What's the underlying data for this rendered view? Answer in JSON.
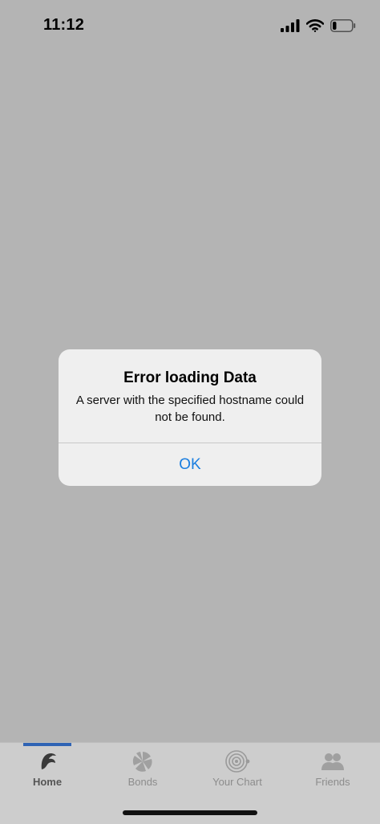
{
  "status_bar": {
    "time": "11:12",
    "icons": [
      "signal-icon",
      "wifi-icon",
      "battery-icon"
    ],
    "battery_level": 0.2
  },
  "alert": {
    "title": "Error loading Data",
    "message": "A server with the specified hostname could not be found.",
    "ok_label": "OK",
    "ok_color": "#1a7ee0"
  },
  "tab_bar": {
    "selected": "Home",
    "accent_color": "#2f63b4",
    "tabs": [
      {
        "label": "Home",
        "icon": "home-icon"
      },
      {
        "label": "Bonds",
        "icon": "bonds-icon"
      },
      {
        "label": "Your Chart",
        "icon": "chart-icon"
      },
      {
        "label": "Friends",
        "icon": "friends-icon"
      }
    ]
  },
  "colors": {
    "background": "#b4b4b4",
    "alert_background": "#efefef",
    "tab_bar_background": "#cdcdcd"
  }
}
